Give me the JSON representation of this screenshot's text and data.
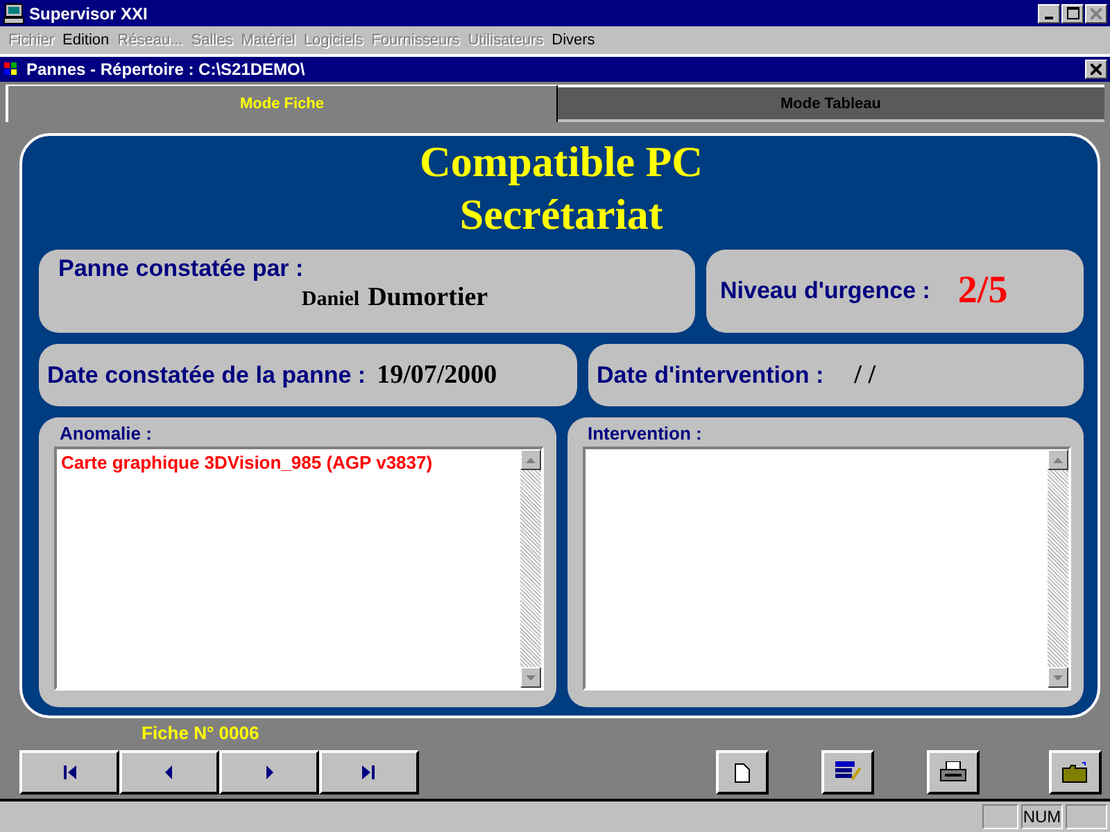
{
  "window": {
    "title": "Supervisor XXI"
  },
  "menu": [
    {
      "label": "Fichier",
      "disabled": true
    },
    {
      "label": "Edition",
      "disabled": false
    },
    {
      "label": "Réseau...",
      "disabled": true
    },
    {
      "label": "Salles",
      "disabled": true
    },
    {
      "label": "Matériel",
      "disabled": true
    },
    {
      "label": "Logiciels",
      "disabled": true
    },
    {
      "label": "Fournisseurs",
      "disabled": true
    },
    {
      "label": "Utilisateurs",
      "disabled": true
    },
    {
      "label": "Divers",
      "disabled": false
    }
  ],
  "child_window": {
    "title": "Pannes - Répertoire : C:\\S21DEMO\\"
  },
  "tabs": [
    {
      "label": "Mode Fiche",
      "selected": true
    },
    {
      "label": "Mode Tableau",
      "selected": false
    }
  ],
  "record": {
    "title_line_1": "Compatible PC",
    "title_line_2": "Secrétariat",
    "reported_by_label": "Panne constatée par :",
    "first_name": "Daniel",
    "last_name": "Dumortier",
    "urgency_label": "Niveau d'urgence :",
    "urgency": "2/5",
    "date_label": "Date constatée de la panne :",
    "date": "19/07/2000",
    "intervention_date_label": "Date d'intervention :",
    "intervention_date": "/ /",
    "anomaly_label": "Anomalie :",
    "anomaly": "Carte graphique 3DVision_985 (AGP v3837)",
    "intervention_label": "Intervention :"
  },
  "record_number": "Fiche N° 0006",
  "status_bar": {
    "num_indicator": "NUM"
  }
}
